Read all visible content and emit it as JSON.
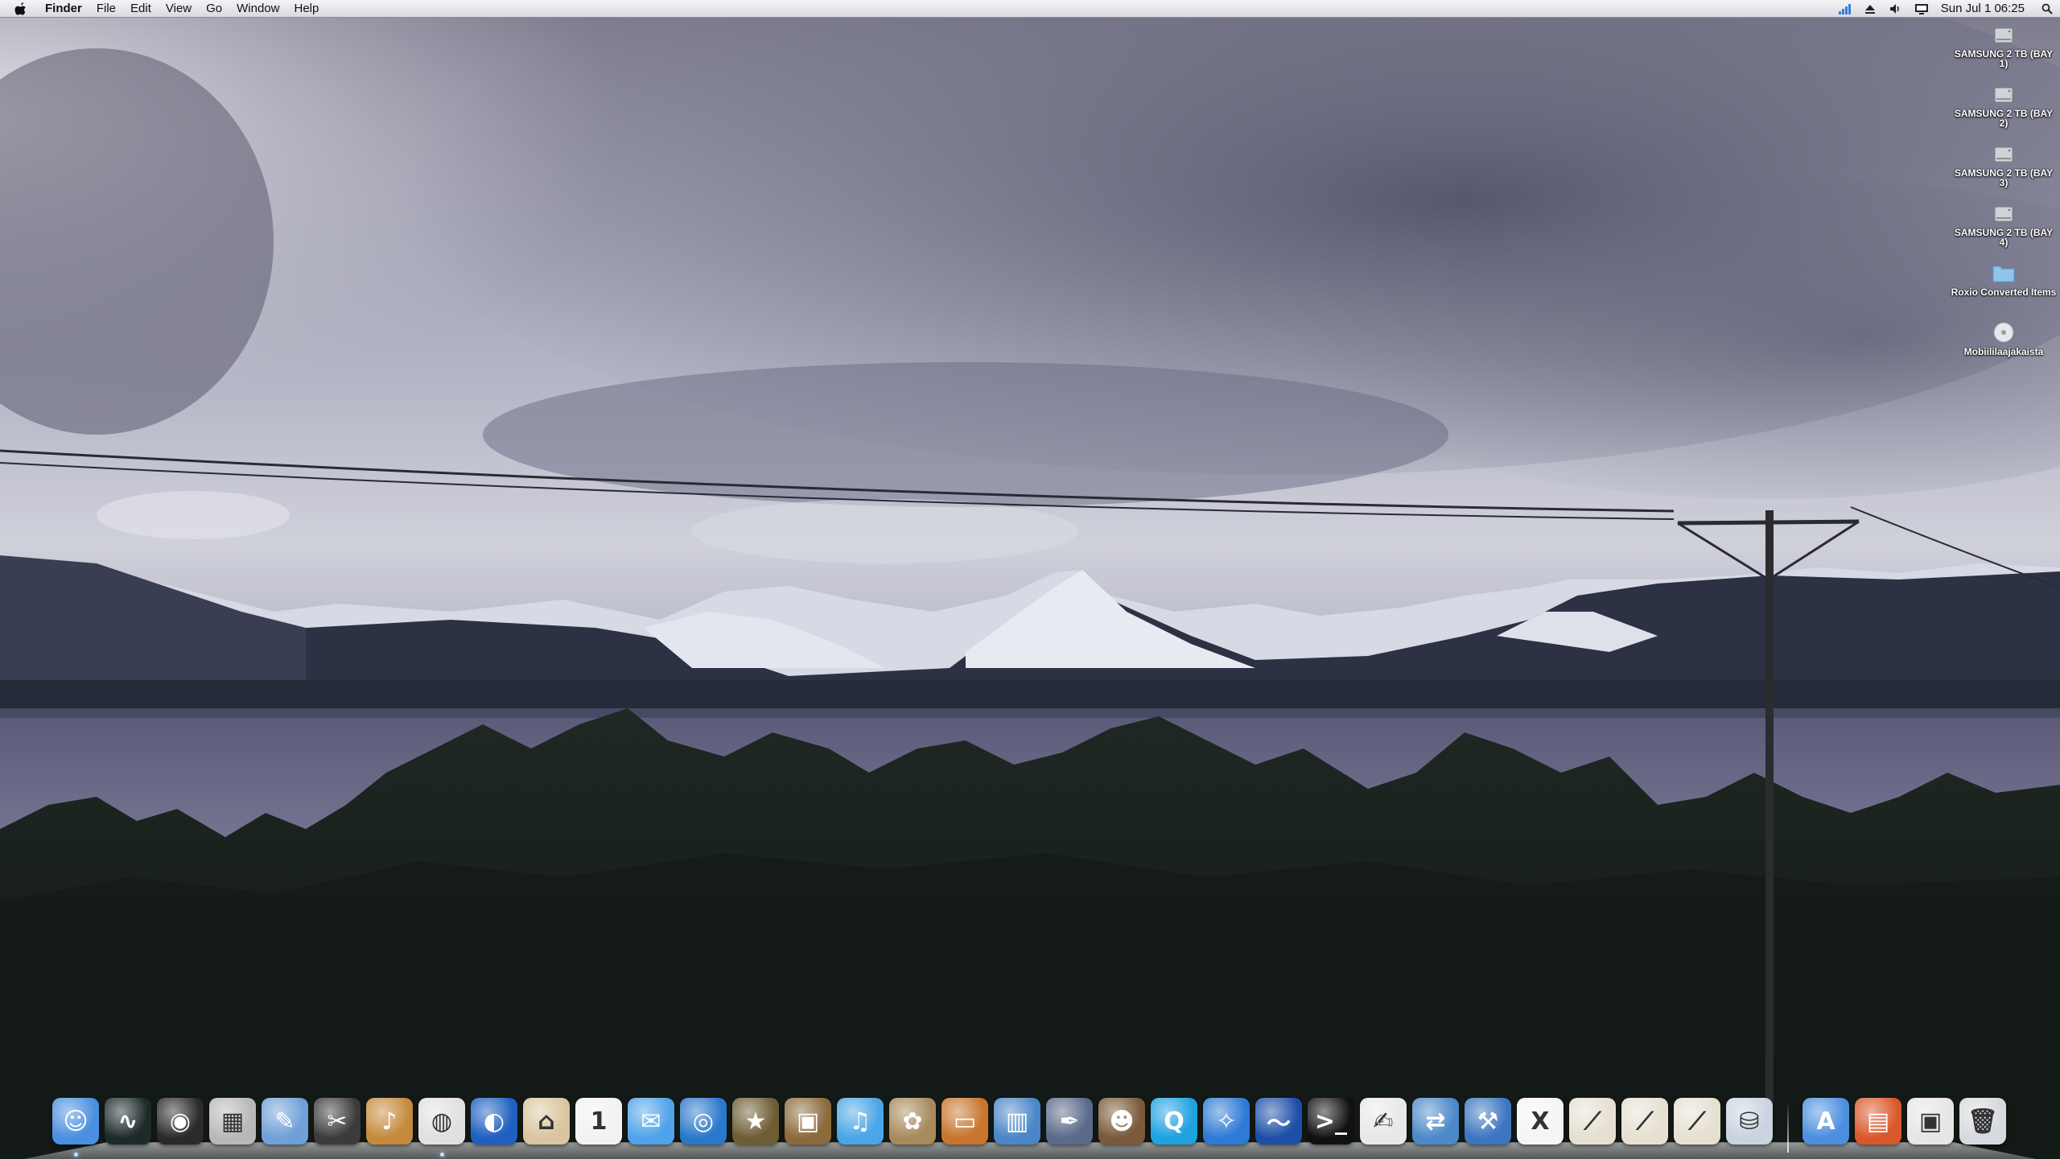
{
  "menubar": {
    "app_name": "Finder",
    "menus": [
      "File",
      "Edit",
      "View",
      "Go",
      "Window",
      "Help"
    ],
    "clock": "Sun Jul 1  06:25",
    "status_icons": [
      "wifi-icon",
      "eject-icon",
      "volume-icon",
      "display-icon",
      "spotlight-icon"
    ]
  },
  "desktop": {
    "icons": [
      {
        "label": "SAMSUNG 2 TB (BAY 1)",
        "icon": "hard-drive-icon"
      },
      {
        "label": "SAMSUNG 2 TB (BAY 2)",
        "icon": "hard-drive-icon"
      },
      {
        "label": "SAMSUNG 2 TB (BAY 3)",
        "icon": "hard-drive-icon"
      },
      {
        "label": "SAMSUNG 2 TB (BAY 4)",
        "icon": "hard-drive-icon"
      },
      {
        "label": "Roxio Converted Items",
        "icon": "folder-icon"
      },
      {
        "label": "Mobiililaajakaista",
        "icon": "disc-icon"
      }
    ]
  },
  "dock": {
    "apps": [
      {
        "name": "finder",
        "color": "#4a8fe0",
        "glyph": "☺",
        "running": true
      },
      {
        "name": "activity-monitor",
        "color": "#1c2a2a",
        "glyph": "∿",
        "running": false
      },
      {
        "name": "aperture",
        "color": "#2a2a2a",
        "glyph": "◉",
        "running": false
      },
      {
        "name": "calculator",
        "color": "#b8b8b8",
        "glyph": "▦",
        "running": false
      },
      {
        "name": "preview-scanner",
        "color": "#6fa0d8",
        "glyph": "✎",
        "running": false
      },
      {
        "name": "final-cut-pro",
        "color": "#3b3b3b",
        "glyph": "✂",
        "running": false
      },
      {
        "name": "garageband",
        "color": "#c58a3c",
        "glyph": "♪",
        "running": false
      },
      {
        "name": "google-chrome",
        "color": "#e0e0e0",
        "glyph": "◍",
        "running": true
      },
      {
        "name": "google-earth",
        "color": "#1f5fbf",
        "glyph": "◐",
        "running": false
      },
      {
        "name": "iphoto-home",
        "color": "#d9c6a0",
        "glyph": "⌂",
        "running": false
      },
      {
        "name": "ical",
        "color": "#f2f2f2",
        "glyph": "1",
        "running": false
      },
      {
        "name": "ichat",
        "color": "#4fa3ea",
        "glyph": "✉",
        "running": false
      },
      {
        "name": "dvd-player",
        "color": "#2a78c9",
        "glyph": "◎",
        "running": false
      },
      {
        "name": "imovie",
        "color": "#6e5d34",
        "glyph": "★",
        "running": false
      },
      {
        "name": "iphoto",
        "color": "#8c6a3c",
        "glyph": "▣",
        "running": false
      },
      {
        "name": "itunes",
        "color": "#4aa6e6",
        "glyph": "♫",
        "running": false
      },
      {
        "name": "iweb",
        "color": "#a88a5c",
        "glyph": "✿",
        "running": false
      },
      {
        "name": "keynote",
        "color": "#c8752d",
        "glyph": "▭",
        "running": false
      },
      {
        "name": "numbers",
        "color": "#4a86c8",
        "glyph": "▥",
        "running": false
      },
      {
        "name": "pixelmator",
        "color": "#5a6a8a",
        "glyph": "✒",
        "running": false
      },
      {
        "name": "photo-booth",
        "color": "#7a5a3a",
        "glyph": "☻",
        "running": false
      },
      {
        "name": "quicktime",
        "color": "#1fa2e0",
        "glyph": "Q",
        "running": false
      },
      {
        "name": "safari",
        "color": "#2d7bd6",
        "glyph": "✧",
        "running": false
      },
      {
        "name": "seashore",
        "color": "#1d4fa8",
        "glyph": "〜",
        "running": false
      },
      {
        "name": "terminal",
        "color": "#111111",
        "glyph": ">_",
        "running": false
      },
      {
        "name": "textedit",
        "color": "#e8e8e8",
        "glyph": "✍",
        "running": false
      },
      {
        "name": "migration-assistant",
        "color": "#4c89c9",
        "glyph": "⇄",
        "running": false
      },
      {
        "name": "xcode",
        "color": "#3c76c0",
        "glyph": "⚒",
        "running": false
      },
      {
        "name": "x11",
        "color": "#f5f5f5",
        "glyph": "X",
        "running": false
      },
      {
        "name": "instruments-1",
        "color": "#e6e0d2",
        "glyph": "⟋",
        "running": false
      },
      {
        "name": "instruments-2",
        "color": "#e6e0d2",
        "glyph": "⟋",
        "running": false
      },
      {
        "name": "instruments-3",
        "color": "#e6e0d2",
        "glyph": "⟋",
        "running": false
      },
      {
        "name": "disk-utility",
        "color": "#c9d4e0",
        "glyph": "⛁",
        "running": false
      }
    ],
    "stacks": [
      {
        "name": "applications-stack",
        "color": "#4c8fe0",
        "glyph": "A"
      },
      {
        "name": "documents-stack",
        "color": "#d9582b",
        "glyph": "▤"
      },
      {
        "name": "downloads-stack",
        "color": "#e6e6e6",
        "glyph": "▣"
      },
      {
        "name": "trash",
        "color": "#d6d9de",
        "glyph": "🗑"
      }
    ]
  }
}
